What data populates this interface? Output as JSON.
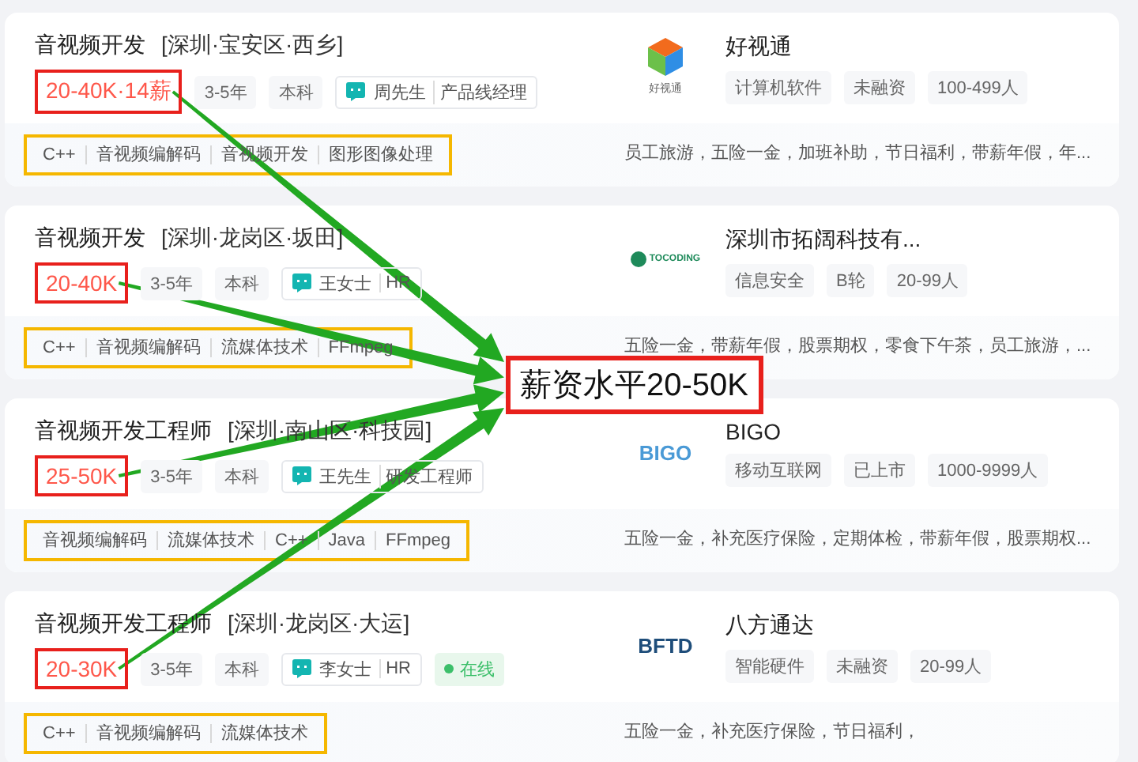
{
  "jobs": [
    {
      "title": "音视频开发",
      "location": "[深圳·宝安区·西乡]",
      "salary": "20-40K·14薪",
      "salary_highlighted": true,
      "tags": [
        "3-5年",
        "本科"
      ],
      "recruiter": {
        "name": "周先生",
        "role": "产品线经理"
      },
      "skills": [
        "C++",
        "音视频编解码",
        "音视频开发",
        "图形图像处理"
      ],
      "skills_highlighted": true,
      "arrow": true,
      "company": {
        "name": "好视通",
        "logo": {
          "kind": "cube",
          "text": "好视通"
        },
        "tags": [
          "计算机软件",
          "未融资",
          "100-499人"
        ],
        "benefits": "员工旅游，五险一金，加班补助，节日福利，带薪年假，年..."
      }
    },
    {
      "title": "音视频开发",
      "location": "[深圳·龙岗区·坂田]",
      "salary": "20-40K",
      "salary_highlighted": true,
      "tags": [
        "3-5年",
        "本科"
      ],
      "recruiter": {
        "name": "王女士",
        "role": "HR"
      },
      "skills": [
        "C++",
        "音视频编解码",
        "流媒体技术",
        "FFmpeg"
      ],
      "skills_highlighted": true,
      "arrow": true,
      "company": {
        "name": "深圳市拓阔科技有...",
        "logo": {
          "kind": "tocoding",
          "text": "TOCODING"
        },
        "tags": [
          "信息安全",
          "B轮",
          "20-99人"
        ],
        "benefits": "五险一金，带薪年假，股票期权，零食下午茶，员工旅游，..."
      }
    },
    {
      "title": "音视频开发工程师",
      "location": "[深圳·南山区·科技园]",
      "salary": "25-50K",
      "salary_highlighted": true,
      "tags": [
        "3-5年",
        "本科"
      ],
      "recruiter": {
        "name": "王先生",
        "role": "研发工程师"
      },
      "skills": [
        "音视频编解码",
        "流媒体技术",
        "C++",
        "Java",
        "FFmpeg"
      ],
      "skills_highlighted": true,
      "arrow": true,
      "company": {
        "name": "BIGO",
        "logo": {
          "kind": "bigo",
          "text": "BIGO"
        },
        "tags": [
          "移动互联网",
          "已上市",
          "1000-9999人"
        ],
        "benefits": "五险一金，补充医疗保险，定期体检，带薪年假，股票期权..."
      }
    },
    {
      "title": "音视频开发工程师",
      "location": "[深圳·龙岗区·大运]",
      "salary": "20-30K",
      "salary_highlighted": true,
      "tags": [
        "3-5年",
        "本科"
      ],
      "recruiter": {
        "name": "李女士",
        "role": "HR"
      },
      "status": "在线",
      "skills": [
        "C++",
        "音视频编解码",
        "流媒体技术"
      ],
      "skills_highlighted": true,
      "arrow": true,
      "company": {
        "name": "八方通达",
        "logo": {
          "kind": "bftd",
          "text": "BFTD"
        },
        "tags": [
          "智能硬件",
          "未融资",
          "20-99人"
        ],
        "benefits": "五险一金，补充医疗保险，节日福利，"
      }
    }
  ],
  "callout": {
    "text": "薪资水平20-50K"
  }
}
